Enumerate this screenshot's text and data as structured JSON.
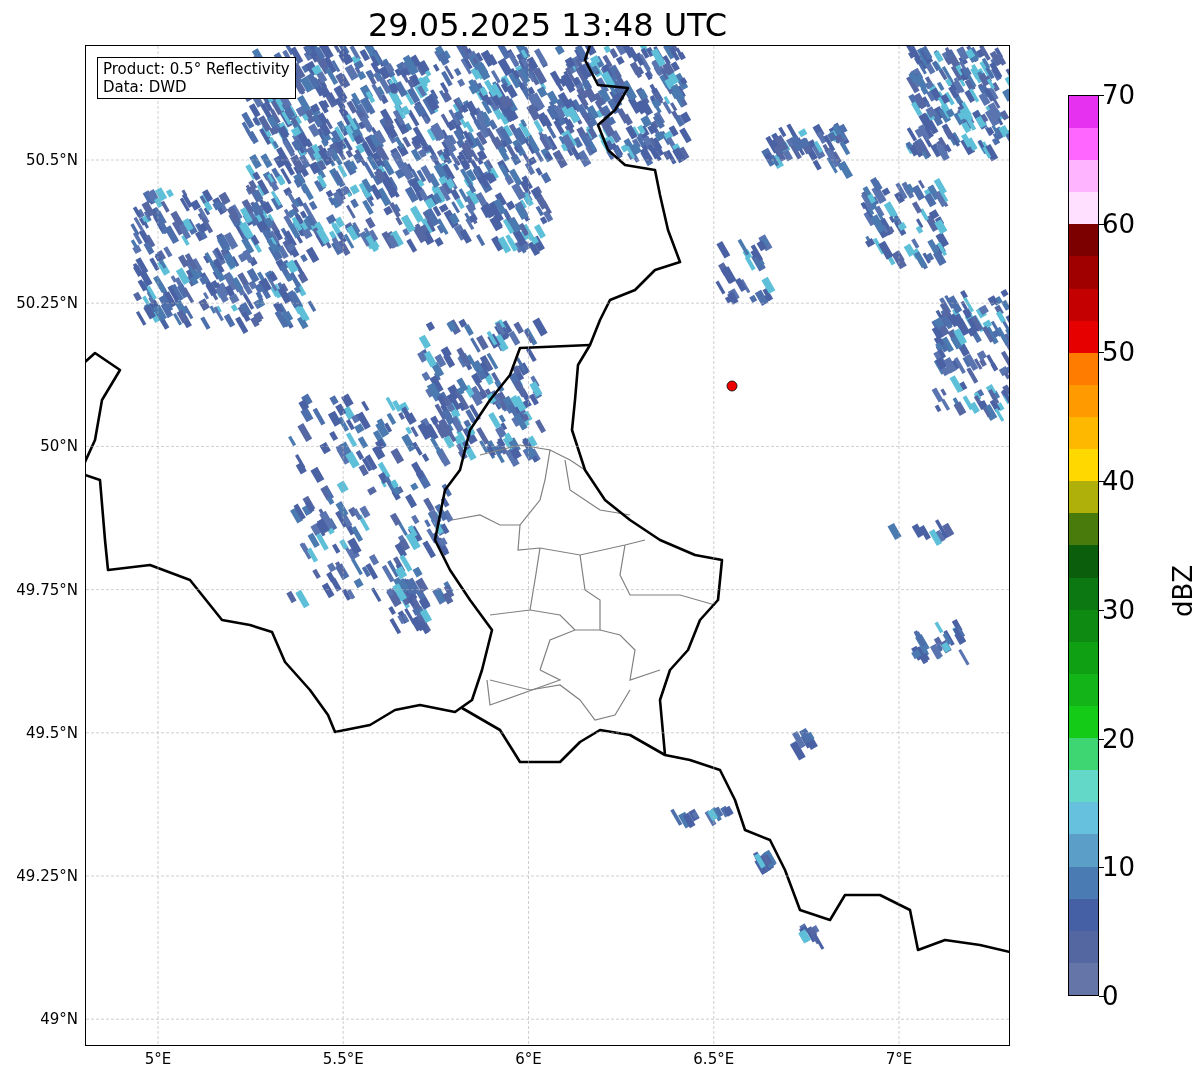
{
  "title": "29.05.2025 13:48 UTC",
  "info_box": [
    "Product: 0.5° Reflectivity",
    "Data: DWD"
  ],
  "map": {
    "x_ticks": [
      "5°E",
      "5.5°E",
      "6°E",
      "6.5°E",
      "7°E"
    ],
    "y_ticks": [
      "50.5°N",
      "50.25°N",
      "50°N",
      "49.75°N",
      "49.5°N",
      "49.25°N",
      "49°N"
    ]
  },
  "colorbar": {
    "label": "dBZ",
    "ticks": [
      "70",
      "60",
      "50",
      "40",
      "30",
      "20",
      "10",
      "0"
    ],
    "bins": [
      {
        "color": "#6675a8"
      },
      {
        "color": "#5567a0"
      },
      {
        "color": "#4560a5"
      },
      {
        "color": "#4a7bb2"
      },
      {
        "color": "#5b9fc8"
      },
      {
        "color": "#66c1de"
      },
      {
        "color": "#63d8c8"
      },
      {
        "color": "#3dd673"
      },
      {
        "color": "#14cc18"
      },
      {
        "color": "#12b418"
      },
      {
        "color": "#10a014"
      },
      {
        "color": "#0e8a12"
      },
      {
        "color": "#0c7812"
      },
      {
        "color": "#0a5e0c"
      },
      {
        "color": "#487a0c"
      },
      {
        "color": "#b0b00a"
      },
      {
        "color": "#ffd800"
      },
      {
        "color": "#ffb800"
      },
      {
        "color": "#ff9a00"
      },
      {
        "color": "#ff7c00"
      },
      {
        "color": "#e60000"
      },
      {
        "color": "#c40000"
      },
      {
        "color": "#a00000"
      },
      {
        "color": "#7c0000"
      },
      {
        "color": "#ffe0ff"
      },
      {
        "color": "#ffb4ff"
      },
      {
        "color": "#ff66ff"
      },
      {
        "color": "#e632f0"
      }
    ]
  }
}
